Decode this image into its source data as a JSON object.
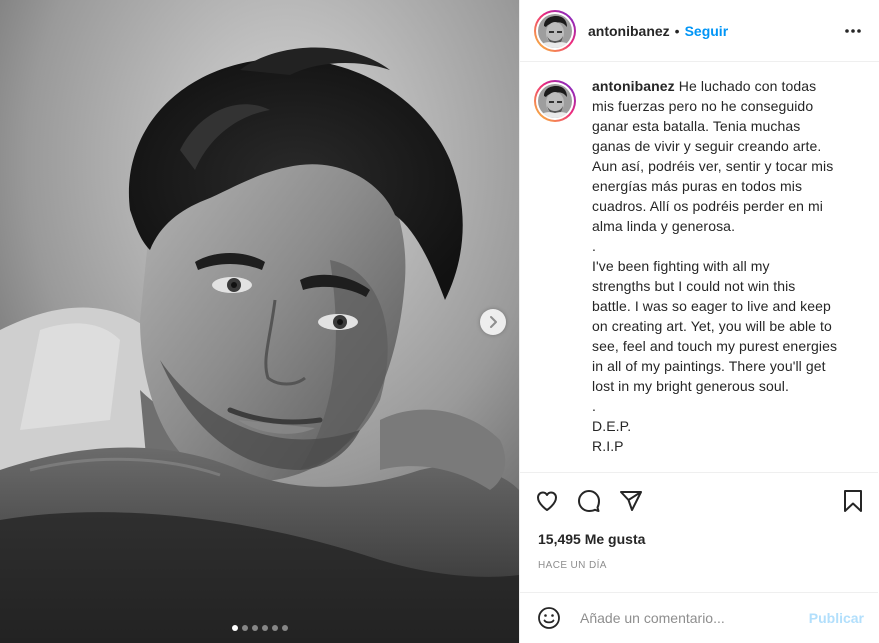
{
  "header": {
    "username": "antonibanez",
    "separator": "•",
    "follow_label": "Seguir"
  },
  "caption": {
    "username": "antonibanez",
    "spanish_lines": [
      "He luchado con todas",
      "mis fuerzas pero no he conseguido",
      "ganar esta batalla. Tenia muchas",
      "ganas de vivir y seguir creando arte.",
      "Aun así, podréis ver, sentir y tocar mis",
      "energías más puras en todos mis",
      "cuadros. Allí os podréis perder en mi",
      "alma linda y generosa.",
      "."
    ],
    "english_lines": [
      "I've been fighting with all my",
      "strengths but I could not win this",
      "battle. I was so eager to live and keep",
      "on creating art. Yet, you will be able to",
      "see, feel and touch my purest energies",
      "in all of my paintings. There you'll get",
      "lost in my bright generous soul.",
      "."
    ],
    "closing_lines": [
      "D.E.P.",
      "R.I.P"
    ]
  },
  "likes_text": "15,495 Me gusta",
  "timestamp": "HACE UN DÍA",
  "comment": {
    "value": "",
    "placeholder": "Añade un comentario...",
    "post_label": "Publicar"
  },
  "carousel": {
    "slide_count": 6,
    "active_index": 0
  },
  "icons": {
    "more": "more-horizontal-icon",
    "like": "heart-icon",
    "comment": "comment-icon",
    "share": "paper-plane-icon",
    "save": "bookmark-icon",
    "emoji": "smiley-icon",
    "next": "chevron-right-icon"
  },
  "colors": {
    "follow": "#0095f6",
    "post_button_disabled": "#b2dffc",
    "muted_text": "#8e8e8e",
    "primary_text": "#262626",
    "border": "#efefef"
  }
}
